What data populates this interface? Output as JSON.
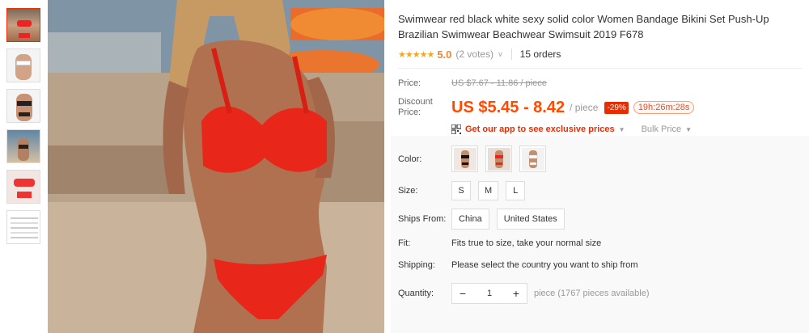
{
  "product": {
    "title": "Swimwear red black white sexy solid color Women Bandage Bikini Set Push-Up Brazilian Swimwear Beachwear Swimsuit 2019 F678",
    "stars": "★★★★★",
    "rating": "5.0",
    "votes": "(2 votes)",
    "orders": "15 orders"
  },
  "price": {
    "label": "Price:",
    "original": "US $7.67 - 11.86 / piece",
    "discount_label": "Discount Price:",
    "discount": "US $5.45 - 8.42",
    "per": "/ piece",
    "discount_badge": "-29%",
    "timer": "19h:26m:28s",
    "app_promo": "Get our app to see exclusive prices",
    "bulk": "Bulk Price"
  },
  "options": {
    "color_label": "Color:",
    "size_label": "Size:",
    "sizes": [
      "S",
      "M",
      "L"
    ],
    "ships_label": "Ships From:",
    "ships": [
      "China",
      "United States"
    ],
    "fit_label": "Fit:",
    "fit_text": "Fits true to size, take your normal size",
    "shipping_label": "Shipping:",
    "shipping_text": "Please select the country you want to ship from",
    "quantity_label": "Quantity:",
    "quantity_value": "1",
    "quantity_available": "piece (1767 pieces available)"
  },
  "colors": {
    "accent": "#e62e04",
    "price": "#ff4a00",
    "star": "#f5a623"
  }
}
